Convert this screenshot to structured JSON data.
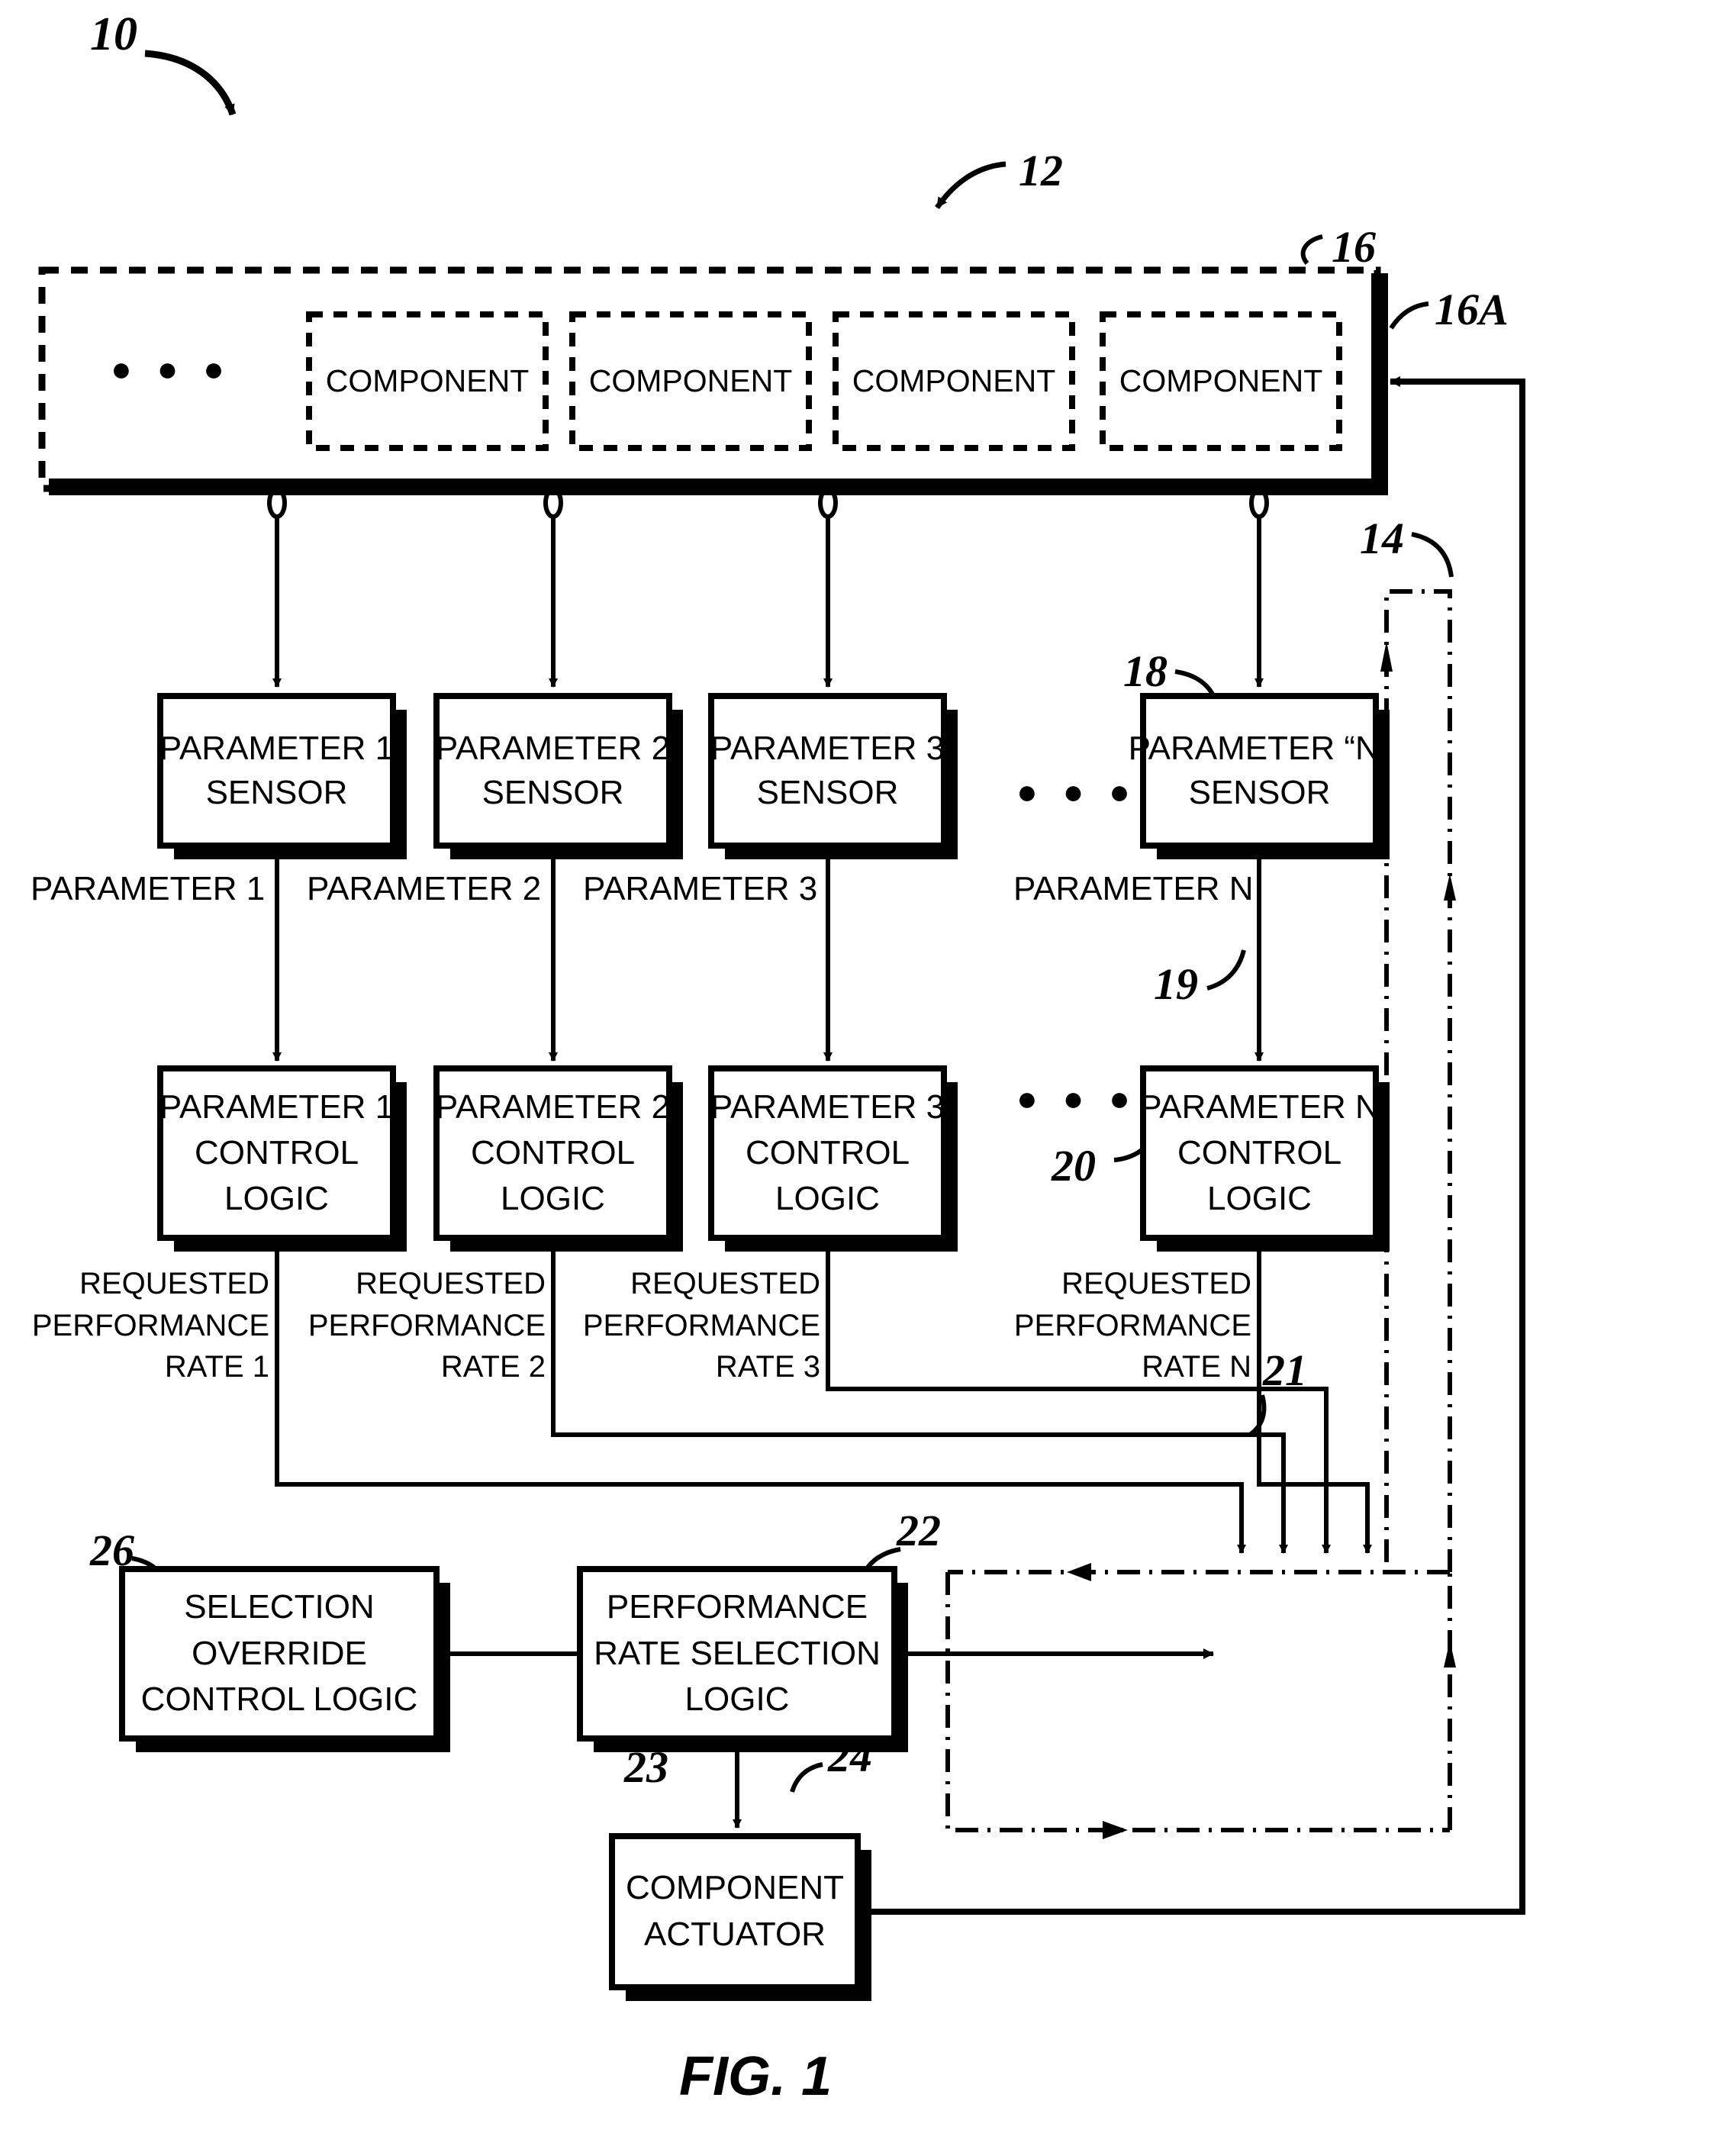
{
  "figure": {
    "label": "FIG. 1",
    "ellipsis": "● ● ●"
  },
  "reference_numerals": {
    "system": "10",
    "control_system": "12",
    "feedback_loop": "14",
    "enclosure": "16",
    "enclosure_wall": "16A",
    "sensor_group": "18",
    "sensor_output_line": "19",
    "control_logic_group": "20",
    "requested_rate_line": "21",
    "rate_selection_logic": "22",
    "selected_rate_line": "23",
    "component_actuator": "24",
    "selection_override": "26"
  },
  "enclosure": {
    "components": [
      {
        "label": "COMPONENT"
      },
      {
        "label": "COMPONENT"
      },
      {
        "label": "COMPONENT"
      },
      {
        "label": "COMPONENT"
      }
    ]
  },
  "sensors": [
    {
      "line1": "PARAMETER 1",
      "line2": "SENSOR"
    },
    {
      "line1": "PARAMETER 2",
      "line2": "SENSOR"
    },
    {
      "line1": "PARAMETER 3",
      "line2": "SENSOR"
    },
    {
      "line1": "PARAMETER “N”",
      "line2": "SENSOR"
    }
  ],
  "parameter_signals": [
    {
      "label": "PARAMETER 1"
    },
    {
      "label": "PARAMETER 2"
    },
    {
      "label": "PARAMETER 3"
    },
    {
      "label": "PARAMETER N"
    }
  ],
  "control_logics": [
    {
      "line1": "PARAMETER 1",
      "line2": "CONTROL",
      "line3": "LOGIC"
    },
    {
      "line1": "PARAMETER 2",
      "line2": "CONTROL",
      "line3": "LOGIC"
    },
    {
      "line1": "PARAMETER 3",
      "line2": "CONTROL",
      "line3": "LOGIC"
    },
    {
      "line1": "PARAMETER N",
      "line2": "CONTROL",
      "line3": "LOGIC"
    }
  ],
  "requested_rates": [
    {
      "line1": "REQUESTED",
      "line2": "PERFORMANCE",
      "line3": "RATE 1"
    },
    {
      "line1": "REQUESTED",
      "line2": "PERFORMANCE",
      "line3": "RATE 2"
    },
    {
      "line1": "REQUESTED",
      "line2": "PERFORMANCE",
      "line3": "RATE 3"
    },
    {
      "line1": "REQUESTED",
      "line2": "PERFORMANCE",
      "line3": "RATE N"
    }
  ],
  "selection_override_logic": {
    "line1": "SELECTION",
    "line2": "OVERRIDE",
    "line3": "CONTROL LOGIC"
  },
  "rate_selection_logic": {
    "line1": "PERFORMANCE",
    "line2": "RATE SELECTION",
    "line3": "LOGIC"
  },
  "component_actuator": {
    "line1": "COMPONENT",
    "line2": "ACTUATOR"
  },
  "colors": {
    "stroke": "#000000",
    "background": "#ffffff"
  }
}
